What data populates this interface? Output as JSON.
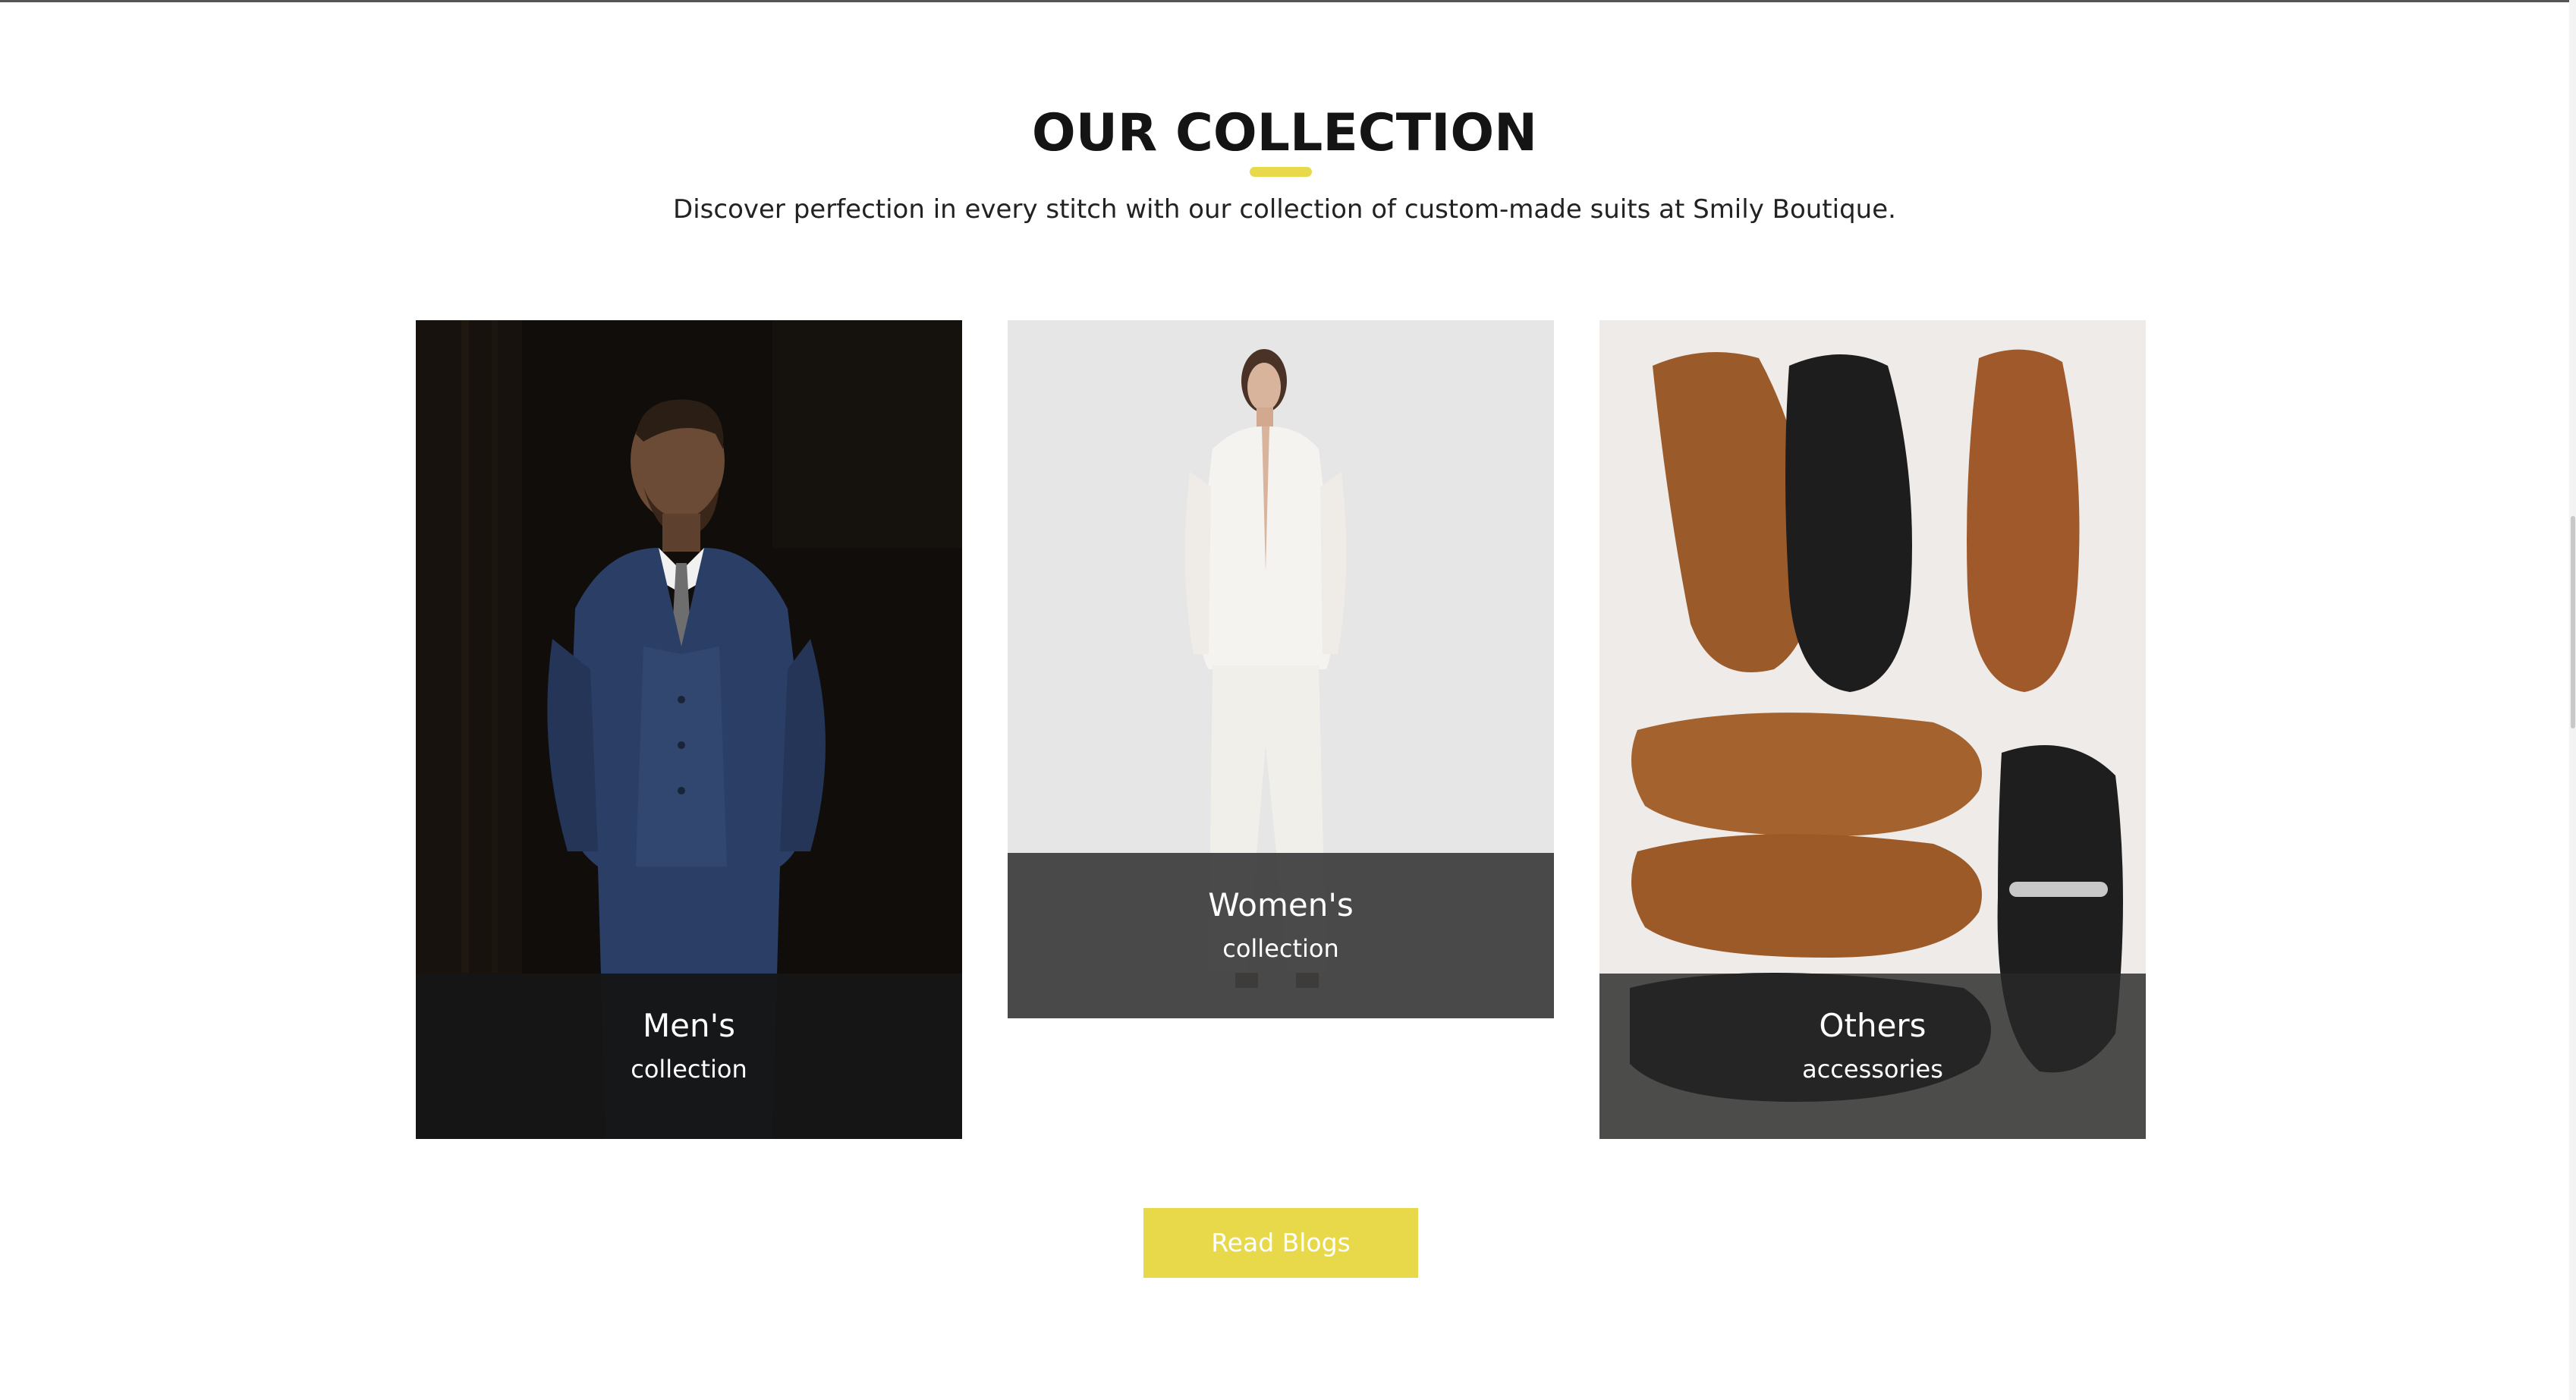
{
  "section": {
    "title": "OUR COLLECTION",
    "subtitle": "Discover perfection in every stitch with our collection of custom-made suits at Smily Boutique.",
    "accent_color": "#e8d94b"
  },
  "cards": [
    {
      "title": "Men's",
      "subtitle": "collection",
      "image": "man-in-blue-three-piece-suit-photo"
    },
    {
      "title": "Women's",
      "subtitle": "collection",
      "image": "woman-in-white-suit-photo"
    },
    {
      "title": "Others",
      "subtitle": "accessories",
      "image": "leather-shoes-flatlay-photo"
    }
  ],
  "cta": {
    "label": "Read Blogs"
  }
}
